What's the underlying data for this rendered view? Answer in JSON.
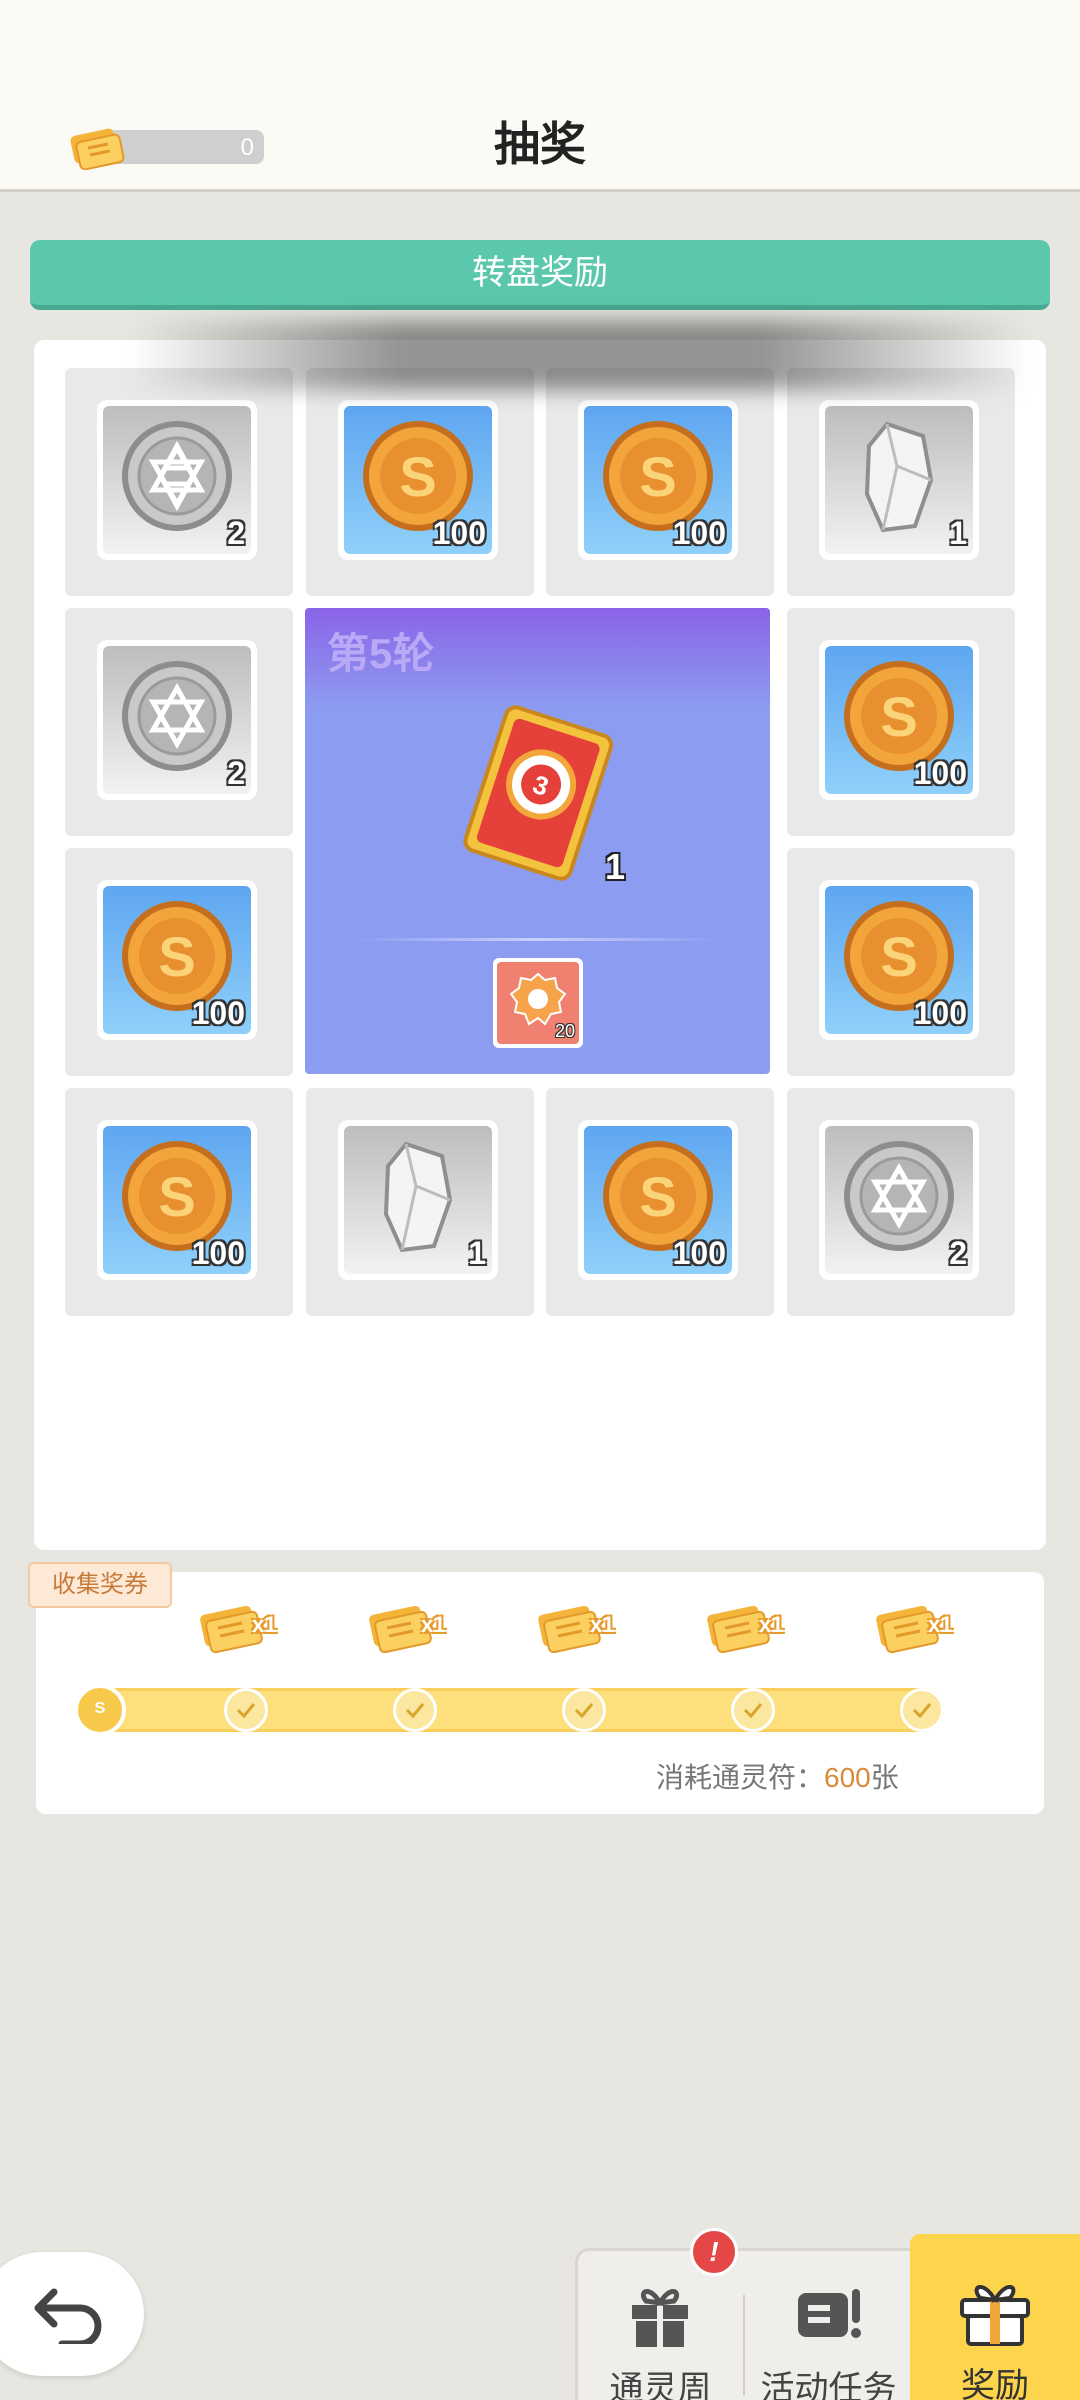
{
  "header": {
    "title": "抽奖",
    "ticket_count": "0"
  },
  "wheel_banner": {
    "label": "转盘奖励"
  },
  "prize_grid": {
    "cells": [
      {
        "type": "silver-star-coin",
        "qty": "2"
      },
      {
        "type": "gold-coin",
        "qty": "100"
      },
      {
        "type": "gold-coin",
        "qty": "100"
      },
      {
        "type": "crystal",
        "qty": "1"
      },
      {
        "type": "silver-star-coin",
        "qty": "2"
      },
      {
        "type": "gold-coin",
        "qty": "100"
      },
      {
        "type": "gold-coin",
        "qty": "100"
      },
      {
        "type": "gold-coin",
        "qty": "100"
      },
      {
        "type": "gold-coin",
        "qty": "100"
      },
      {
        "type": "crystal",
        "qty": "1"
      },
      {
        "type": "gold-coin",
        "qty": "100"
      },
      {
        "type": "silver-star-coin",
        "qty": "2"
      }
    ],
    "center": {
      "round_label": "第5轮",
      "main_reward_qty": "1",
      "sub_reward_qty": "20"
    }
  },
  "collect": {
    "tag_label": "收集奖券",
    "rewards": [
      "x1",
      "x1",
      "x1",
      "x1",
      "x1"
    ],
    "start_node_label": "S",
    "consume_prefix": "消耗通灵符：",
    "consume_amount": "600",
    "consume_suffix": "张"
  },
  "nav": {
    "items": [
      {
        "label": "通灵周",
        "icon": "gift-icon"
      },
      {
        "label": "活动任务",
        "icon": "task-icon"
      },
      {
        "label": "奖励",
        "icon": "gift-icon"
      }
    ],
    "alert_badge": "!"
  },
  "colors": {
    "banner": "#5bc8ae",
    "center_card": "#8c9cf0",
    "active_nav": "#fcd54c",
    "accent_amount": "#d98a3a"
  }
}
